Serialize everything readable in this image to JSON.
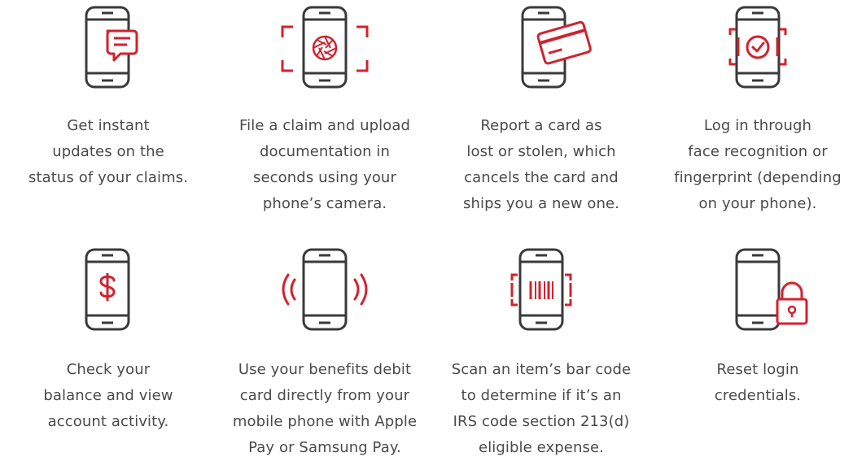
{
  "colors": {
    "icon_outline": "#3a3a3a",
    "accent_red": "#d0232f",
    "text": "#4a4a4a",
    "background": "#ffffff"
  },
  "features": [
    {
      "icon": "phone-message-icon",
      "lines": [
        "Get instant",
        "updates on the",
        "status of your claims."
      ]
    },
    {
      "icon": "phone-camera-icon",
      "lines": [
        "File a claim and upload",
        "documentation in",
        "seconds using your",
        "phone’s camera."
      ]
    },
    {
      "icon": "phone-card-icon",
      "lines": [
        "Report a card as",
        "lost or stolen, which",
        "cancels the card and",
        "ships you a new one."
      ]
    },
    {
      "icon": "phone-face-recognition-icon",
      "lines": [
        "Log in through",
        "face recognition or",
        "fingerprint (depending",
        "on your phone)."
      ]
    },
    {
      "icon": "phone-dollar-icon",
      "lines": [
        "Check your",
        "balance and view",
        "account activity."
      ]
    },
    {
      "icon": "phone-contactless-pay-icon",
      "lines": [
        "Use your benefits debit",
        "card directly from your",
        "mobile phone with Apple",
        "Pay or Samsung Pay."
      ]
    },
    {
      "icon": "phone-barcode-scan-icon",
      "lines": [
        "Scan an item’s bar code",
        "to determine if it’s an",
        "IRS code section 213(d)",
        "eligible expense."
      ]
    },
    {
      "icon": "phone-lock-icon",
      "lines": [
        "Reset login",
        "credentials."
      ]
    }
  ]
}
